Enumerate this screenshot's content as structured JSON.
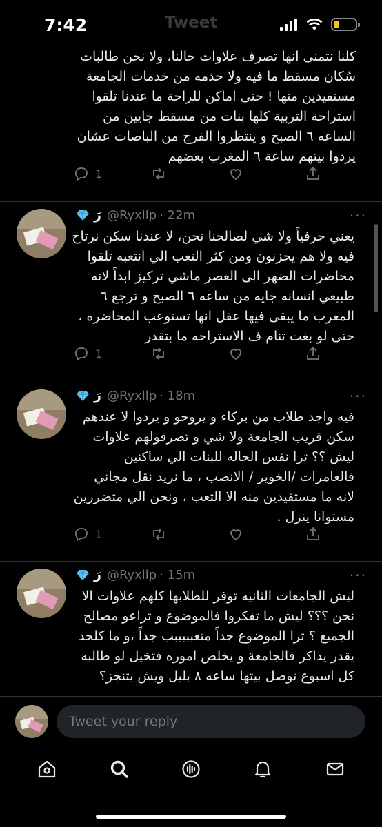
{
  "status_bar": {
    "time": "7:42",
    "title": "Tweet",
    "battery_level": 0.25
  },
  "thread": {
    "first_tweet": {
      "text": "كلنا نتمنى انها تصرف علاوات حالنا، ولا نحن طالبات سُكان مسقط ما فيه ولا خدمه من خدمات الجامعة مستفيدين منها ! حتى اماكن للراحة ما عندنا تلقوا استراحة التربية كلها بنات من مسقط جايين من الساعه ٦ الصبح و ينتظروا الفرج من الباصات عشان يردوا بيتهم ساعة ٦ المغرب بعضهم",
      "reply_count": "1"
    },
    "tweets": [
      {
        "display_name": "رَ",
        "handle": "@Ryxllp",
        "time": "· 22m",
        "text": "يعني حرفياً ولا شي لصالحنا نحن، لا عندنا سكن نرتاح فيه ولا هم يحزنون ومن كثر التعب الي انتعبه تلقوا محاضرات الضهر الى العصر ماشي تركيز ابداً لانه طبيعي انسانه جايه من ساعه ٦ الصبح و ترجع ٦ المغرب ما يبقى فيها عقل انها تستوعب المحاضره ، حتى لو بغت تنام ف الاستراحه ما بتقدر",
        "reply_count": "1"
      },
      {
        "display_name": "رَ",
        "handle": "@Ryxllp",
        "time": "· 18m",
        "text": "فيه واجد طلاب من بركاء و يروحو و يردوا لا عندهم سكن قريب الجامعة ولا شي و تصرفولهم علاوات ليش ؟؟ ترا نفس الحاله للبنات الي ساكنين فالعامرات /الخوير / الانصب ، ما نريد نقل مجاني لانه ما مستفيدين منه الا التعب ، ونحن الي متضررين مستوانا ينزل .",
        "reply_count": "1"
      },
      {
        "display_name": "رَ",
        "handle": "@Ryxllp",
        "time": "· 15m",
        "text": "ليش الجامعات الثانيه توفر للطلابها كلهم علاوات الا نحن ؟؟؟ ليش ما تفكروا فالموضوع و تراعو مصالح الجميع ؟ ترا الموضوع جداً متعبببببب جداً ،و ما كلحد يقدر يذاكر فالجامعة و يخلص اموره فتخيل لو طالبه كل اسبوع توصل بيتها ساعه ٨ بليل ويش بتنجز؟",
        "reply_count": ""
      }
    ]
  },
  "reply": {
    "placeholder": "Tweet your reply"
  },
  "icons": {
    "reply": "reply-icon",
    "retweet": "retweet-icon",
    "like": "like-icon",
    "share": "share-icon",
    "verified": "diamond-icon",
    "more": "more-icon"
  },
  "tabs": [
    {
      "name": "home",
      "icon": "home-icon"
    },
    {
      "name": "search",
      "icon": "search-icon"
    },
    {
      "name": "spaces",
      "icon": "spaces-icon"
    },
    {
      "name": "notifications",
      "icon": "bell-icon"
    },
    {
      "name": "messages",
      "icon": "mail-icon"
    }
  ],
  "colors": {
    "background": "#000000",
    "text": "#e7e9ea",
    "muted": "#71767b",
    "divider": "#2f3336",
    "battery": "#f5c518"
  }
}
